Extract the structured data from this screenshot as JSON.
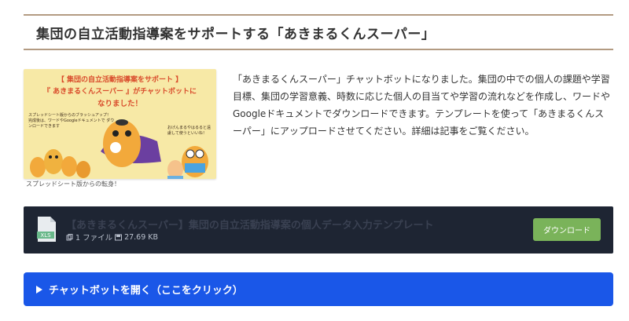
{
  "heading": {
    "title": "集団の自立活動指導案をサポートする「あきまるくんスーパー」"
  },
  "thumbnail": {
    "title_line1": "【 集団の自立活動指導案をサポート 】",
    "title_line2": "『 あきまるくんスーパー 』がチャットボットに",
    "title_line3": "なりました！",
    "left_note": "スプレッドシート版からのブラッシュアップ！ 完成後は、ワードやGoogleドキュメントで ダウンロードできます",
    "right_note": "おげんまるやはるると遠 慮して使うといいね！",
    "caption": "スプレッドシート版からの転身！"
  },
  "description": "「あきまるくんスーパー」チャットボットになりました。集団の中での個人の課題や学習目標、集団の学習意義、時数に応じた個人の目当てや学習の流れなどを作成し、ワードやGoogleドキュメントでダウンロードできます。テンプレートを使って「あきまるくんスーパー」にアップロードさせてください。詳細は記事をご覧ください。",
  "download": {
    "file_title": "【あきまるくんスーパー】集団の自立活動指導案の個人データ入力テンプレート",
    "file_type": "XLS",
    "file_count": "1 ファイル",
    "file_size": "27.69 KB",
    "button_label": "ダウンロード",
    "file_icon": "xls-file-icon"
  },
  "chat": {
    "label": "チャットボットを開く（ここをクリック）",
    "icon": "triangle-right-icon"
  },
  "colors": {
    "heading_border": "#b39b82",
    "download_bg": "#1e2533",
    "download_button": "#7ab35a",
    "chat_bg": "#1a57e8",
    "thumb_bg": "#f7e9a6",
    "thumb_title": "#d94b2b"
  }
}
